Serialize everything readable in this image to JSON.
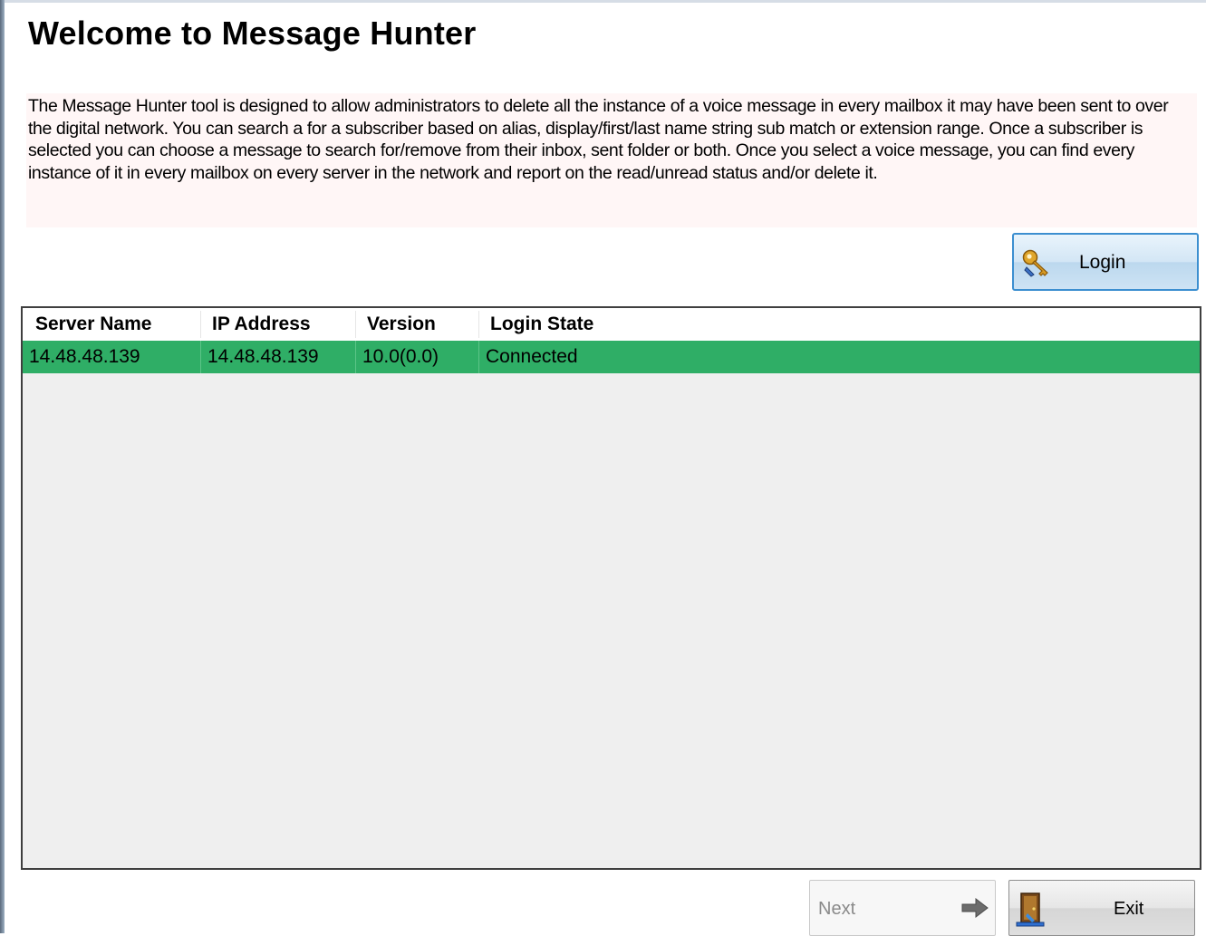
{
  "page": {
    "title": "Welcome to Message Hunter",
    "description": "The Message Hunter tool is designed to allow administrators to delete all the instance of a voice message in every mailbox it may have been sent to over the digital network. You can search a for a subscriber based on alias, display/first/last name string sub match or extension range. Once a subscriber is selected you can choose a message to search for/remove from their inbox, sent folder or both.  Once you select a voice message, you can find every instance of it in every mailbox on every server in the network and report on the read/unread status and/or delete it."
  },
  "login_button": {
    "label": "Login",
    "icon": "key-icon"
  },
  "server_table": {
    "columns": [
      "Server Name",
      "IP Address",
      "Version",
      "Login State"
    ],
    "rows": [
      {
        "server_name": "14.48.48.139",
        "ip_address": "14.48.48.139",
        "version": "10.0(0.0)",
        "login_state": "Connected"
      }
    ],
    "selected_row_color": "#2fae66"
  },
  "footer": {
    "next_label": "Next",
    "next_icon": "arrow-right-icon",
    "exit_label": "Exit",
    "exit_icon": "exit-door-icon"
  }
}
